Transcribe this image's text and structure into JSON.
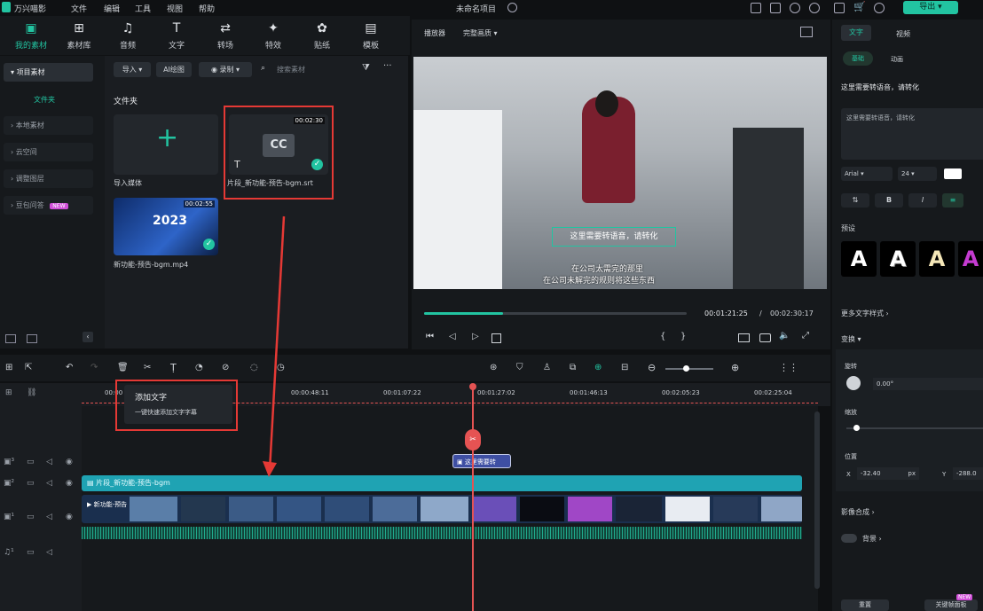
{
  "app": {
    "name": "万兴喵影",
    "menu": [
      "文件",
      "编辑",
      "工具",
      "视图",
      "帮助"
    ],
    "project_title": "未命名项目",
    "export_label": "导出"
  },
  "toolbar": {
    "tools": [
      {
        "label": "我的素材",
        "icon": "media-icon",
        "glyph": "▣",
        "active": true
      },
      {
        "label": "素材库",
        "icon": "stock-icon",
        "glyph": "⊞"
      },
      {
        "label": "音频",
        "icon": "music-icon",
        "glyph": "♫"
      },
      {
        "label": "文字",
        "icon": "text-icon",
        "glyph": "T"
      },
      {
        "label": "转场",
        "icon": "transition-icon",
        "glyph": "⇄"
      },
      {
        "label": "特效",
        "icon": "effects-icon",
        "glyph": "✦"
      },
      {
        "label": "贴纸",
        "icon": "sticker-icon",
        "glyph": "✿"
      },
      {
        "label": "模板",
        "icon": "template-icon",
        "glyph": "▤"
      }
    ]
  },
  "leftnav": {
    "items": [
      "项目素材",
      "文件夹",
      "本地素材",
      "云空间",
      "调整图层",
      "豆包问答"
    ],
    "new_badge": "NEW"
  },
  "library": {
    "import_btn": "导入",
    "ai_btn": "AI绘图",
    "record_btn": "录制",
    "search_placeholder": "搜索素材",
    "folder_label": "文件夹",
    "items": [
      {
        "name": "导入媒体"
      },
      {
        "name": "片段_新功能-预告-bgm.srt",
        "duration": "00:02:30",
        "badge": "CC"
      },
      {
        "name": "新功能-预告-bgm.mp4",
        "duration": "00:02:55",
        "thumb_text": "2023"
      }
    ]
  },
  "preview": {
    "tab_player": "播放器",
    "quality": "完整画质",
    "subtitle_edit": "这里需要转语音，请转化",
    "subtitle_line1": "在公司太需完的那里",
    "subtitle_line2": "在公司未解完的规则将这些东西",
    "current_time": "00:01:21:25",
    "total_time": "00:02:30:17",
    "progress": 0.3
  },
  "rightpanel": {
    "tabs": [
      "文字",
      "视频"
    ],
    "subtabs": [
      "基础",
      "动画"
    ],
    "text_title": "这里需要转语音，请转化",
    "text_content": "这里需要转语音，请转化",
    "font": "Arial",
    "font_size": "24",
    "preset_label": "预设",
    "preset_glyph": "A",
    "more_options": "更多文字样式",
    "transform_label": "变换",
    "rotate_label": "旋转",
    "rotate_value": "0.00°",
    "scale_label": "缩放",
    "position_label": "位置",
    "pos_x_label": "X",
    "pos_x": "-32.40",
    "pos_unit": "px",
    "pos_y_label": "Y",
    "pos_y": "-288.0",
    "blend_label": "影像合成",
    "bg_label": "背景",
    "reset_btn": "重置",
    "keyframe_btn": "关键帧面板",
    "new_badge": "NEW"
  },
  "timeline": {
    "ruler": [
      "00:00",
      "00:00:48:11",
      "00:01:07:22",
      "00:01:27:02",
      "00:01:46:13",
      "00:02:05:23",
      "00:02:25:04"
    ],
    "text_clip": "这里需要转",
    "subtitle_track": "片段_新功能-预告-bgm",
    "video_track": "新功能-预告",
    "popup_item1": "添加文字",
    "popup_item2": "一键快速添加文字字幕"
  },
  "colors": {
    "accent": "#22c4a1",
    "annotation": "#e53935",
    "playhead": "#e55353"
  }
}
